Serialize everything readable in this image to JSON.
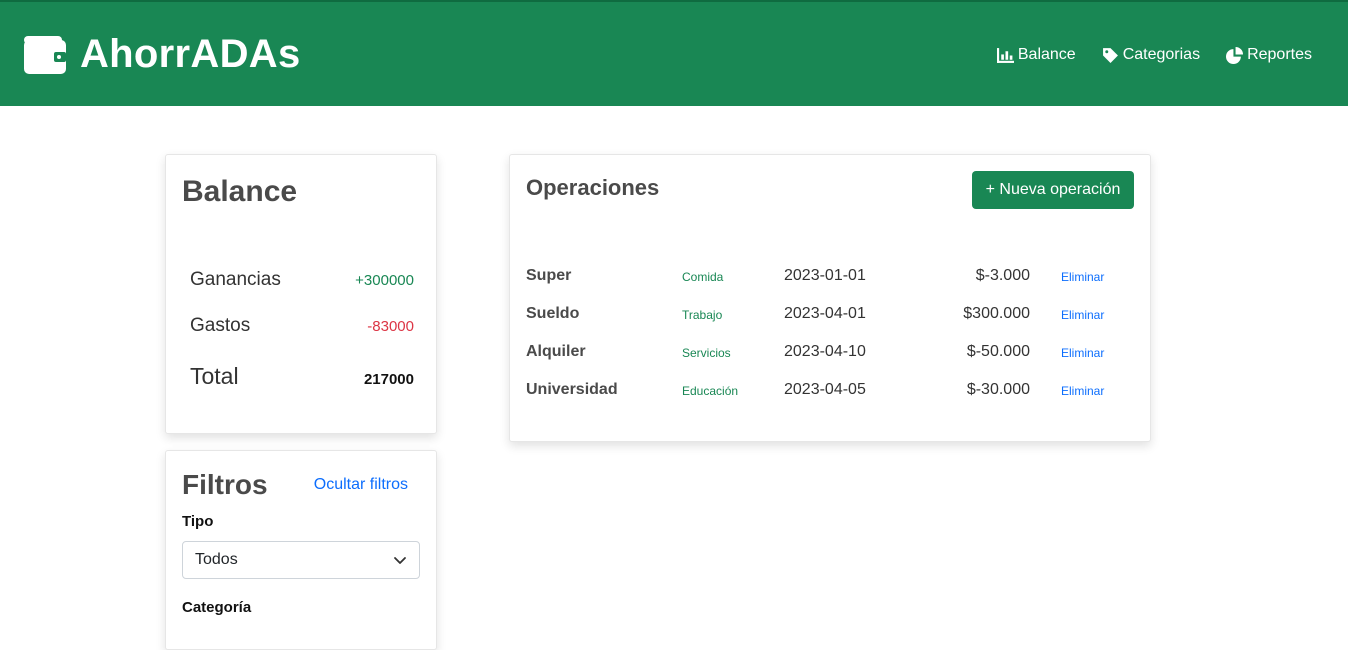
{
  "app": {
    "title": "AhorrADAs",
    "icon": "wallet-icon",
    "accent": "#198754"
  },
  "nav": [
    {
      "label": "Balance",
      "icon": "chart-bar-icon"
    },
    {
      "label": "Categorias",
      "icon": "tag-icon"
    },
    {
      "label": "Reportes",
      "icon": "chart-pie-icon"
    }
  ],
  "balance": {
    "title": "Balance",
    "rows": [
      {
        "label": "Ganancias",
        "value": "+300000",
        "color": "#198754"
      },
      {
        "label": "Gastos",
        "value": "-83000",
        "color": "#dc3545"
      },
      {
        "label": "Total",
        "value": "217000"
      }
    ]
  },
  "filters": {
    "title": "Filtros",
    "toggle_label": "Ocultar filtros",
    "type_label": "Tipo",
    "type_value": "Todos",
    "category_label": "Categoría"
  },
  "operations": {
    "title": "Operaciones",
    "new_button": "+ Nueva operación",
    "rows": [
      {
        "description": "Super",
        "category": "Comida",
        "date": "2023-01-01",
        "amount": "$-3.000",
        "action": "Eliminar"
      },
      {
        "description": "Sueldo",
        "category": "Trabajo",
        "date": "2023-04-01",
        "amount": "$300.000",
        "action": "Eliminar"
      },
      {
        "description": "Alquiler",
        "category": "Servicios",
        "date": "2023-04-10",
        "amount": "$-50.000",
        "action": "Eliminar"
      },
      {
        "description": "Universidad",
        "category": "Educación",
        "date": "2023-04-05",
        "amount": "$-30.000",
        "action": "Eliminar"
      }
    ]
  }
}
